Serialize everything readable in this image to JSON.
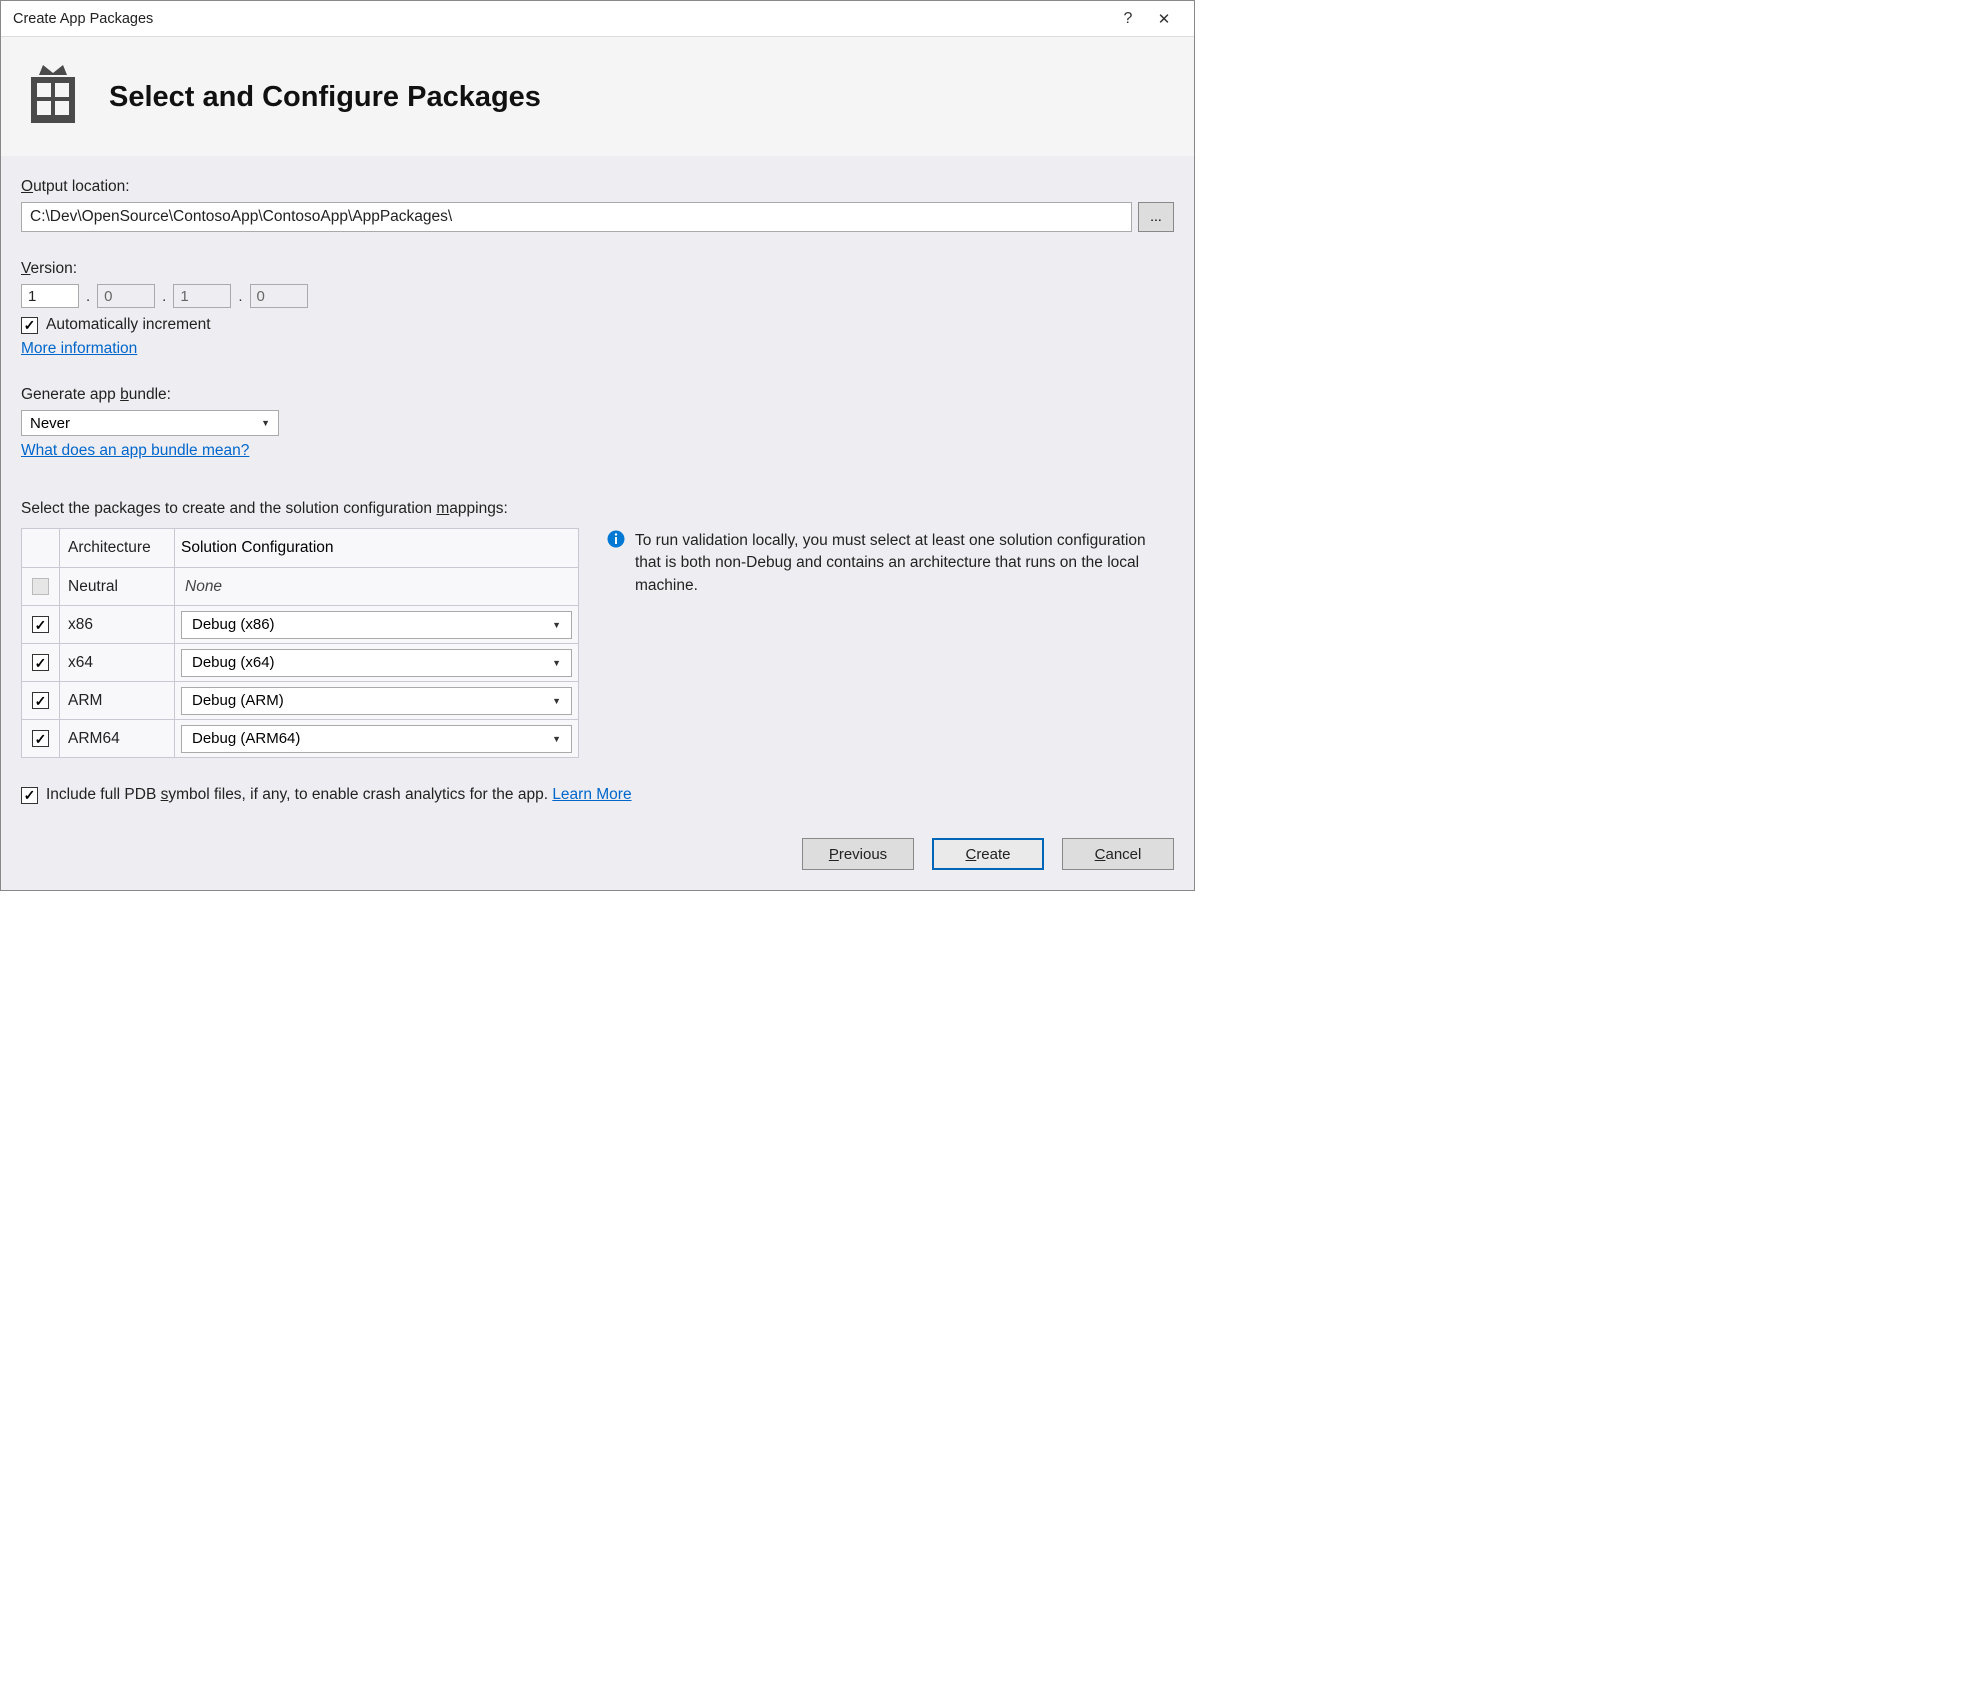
{
  "titlebar": {
    "title": "Create App Packages",
    "help": "?",
    "close": "✕"
  },
  "banner": {
    "heading": "Select and Configure Packages"
  },
  "output": {
    "label": "Output location:",
    "value": "C:\\Dev\\OpenSource\\ContosoApp\\ContosoApp\\AppPackages\\",
    "browse": "..."
  },
  "version": {
    "label": "Version:",
    "major": "1",
    "minor": "0",
    "build": "1",
    "revision": "0",
    "auto_increment_label": "Automatically increment",
    "auto_increment_checked": true,
    "more_info": "More information"
  },
  "bundle": {
    "label_prefix": "Generate app ",
    "label_under": "b",
    "label_suffix": "undle:",
    "value": "Never",
    "help_link": "What does an app bundle mean?"
  },
  "mappings": {
    "label_prefix": "Select the packages to create and the solution configuration ",
    "label_under": "m",
    "label_suffix": "appings:",
    "headers": {
      "arch": "Architecture",
      "config": "Solution Configuration"
    },
    "rows": [
      {
        "checked": false,
        "disabled": true,
        "arch": "Neutral",
        "config": "None",
        "has_select": false
      },
      {
        "checked": true,
        "disabled": false,
        "arch": "x86",
        "config": "Debug (x86)",
        "has_select": true
      },
      {
        "checked": true,
        "disabled": false,
        "arch": "x64",
        "config": "Debug (x64)",
        "has_select": true
      },
      {
        "checked": true,
        "disabled": false,
        "arch": "ARM",
        "config": "Debug (ARM)",
        "has_select": true
      },
      {
        "checked": true,
        "disabled": false,
        "arch": "ARM64",
        "config": "Debug (ARM64)",
        "has_select": true
      }
    ],
    "info_text": "To run validation locally, you must select at least one solution configuration that is both non-Debug and contains an architecture that runs on the local machine."
  },
  "pdb": {
    "checked": true,
    "label_prefix": "Include full PDB ",
    "label_under": "s",
    "label_suffix": "ymbol files, if any, to enable crash analytics for the app. ",
    "learn_more": "Learn More"
  },
  "footer": {
    "previous_pre": "P",
    "previous_rest": "revious",
    "create_pre": "C",
    "create_rest": "reate",
    "cancel_pre": "C",
    "cancel_rest": "ancel"
  }
}
